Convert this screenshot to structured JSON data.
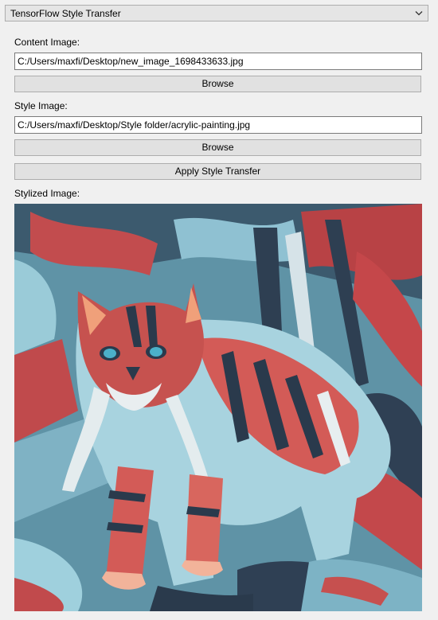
{
  "app": {
    "selector_label": "TensorFlow Style Transfer"
  },
  "content": {
    "label": "Content Image:",
    "path": "C:/Users/maxfi/Desktop/new_image_1698433633.jpg",
    "browse_label": "Browse"
  },
  "style": {
    "label": "Style Image:",
    "path": "C:/Users/maxfi/Desktop/Style folder/acrylic-painting.jpg",
    "browse_label": "Browse"
  },
  "apply_label": "Apply Style Transfer",
  "output": {
    "label": "Stylized Image:"
  },
  "icons": {
    "dropdown": "chevron-down-icon"
  },
  "colors": {
    "window_bg": "#f0f0f0",
    "button_bg": "#e1e1e1",
    "border": "#adadad"
  }
}
